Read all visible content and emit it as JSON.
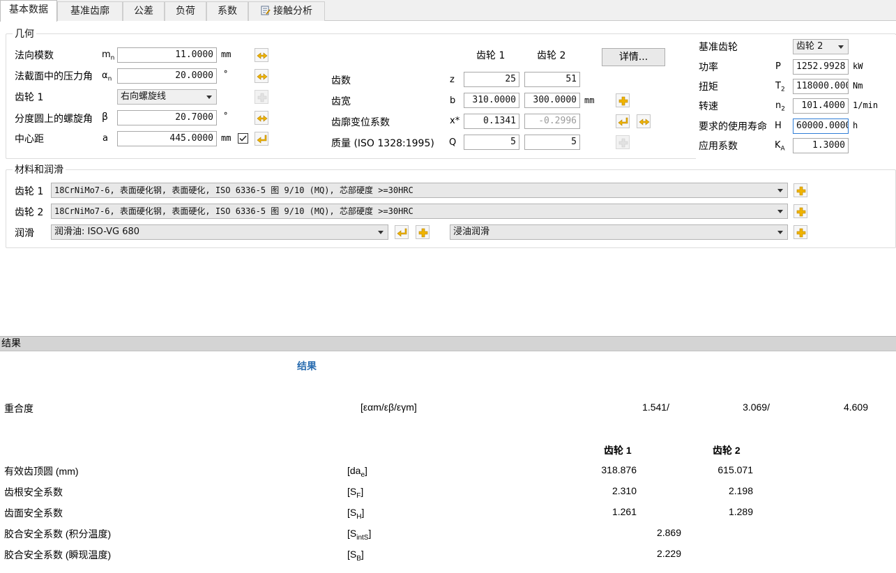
{
  "tabs": [
    "基本数据",
    "基准齿廓",
    "公差",
    "负荷",
    "系数",
    "接触分析"
  ],
  "geometry": {
    "title": "几何",
    "rows": [
      {
        "label": "法向模数",
        "symbol": "m",
        "sub": "n",
        "value": "11.0000",
        "unit": "mm"
      },
      {
        "label": "法截面中的压力角",
        "symbol": "α",
        "sub": "n",
        "value": "20.0000",
        "unit": "°"
      },
      {
        "label": "齿轮 1",
        "combo": "右向螺旋线"
      },
      {
        "label": "分度圆上的螺旋角",
        "symbol": "β",
        "sub": "",
        "value": "20.7000",
        "unit": "°"
      },
      {
        "label": "中心距",
        "symbol": "a",
        "sub": "",
        "value": "445.0000",
        "unit": "mm"
      }
    ],
    "gear1_header": "齿轮 1",
    "gear2_header": "齿轮 2",
    "details_button": "详情...",
    "gear_rows": [
      {
        "label": "齿数",
        "symbol": "z",
        "g1": "25",
        "g2": "51",
        "unit": ""
      },
      {
        "label": "齿宽",
        "symbol": "b",
        "g1": "310.0000",
        "g2": "300.0000",
        "unit": "mm"
      },
      {
        "label": "齿廓变位系数",
        "symbol": "x*",
        "g1": "0.1341",
        "g2": "-0.2996",
        "unit": ""
      },
      {
        "label": "质量 (ISO 1328:1995)",
        "symbol": "Q",
        "g1": "5",
        "g2": "5",
        "unit": ""
      }
    ]
  },
  "load": {
    "rows": [
      {
        "label": "基准齿轮",
        "combo": "齿轮 2"
      },
      {
        "label": "功率",
        "symbol": "P",
        "sub": "",
        "value": "1252.9928",
        "unit": "kW"
      },
      {
        "label": "扭矩",
        "symbol": "T",
        "sub": "2",
        "value": "118000.000",
        "unit": "Nm"
      },
      {
        "label": "转速",
        "symbol": "n",
        "sub": "2",
        "value": "101.4000",
        "unit": "1/min"
      },
      {
        "label": "要求的使用寿命",
        "symbol": "H",
        "sub": "",
        "value": "60000.0000",
        "unit": "h"
      },
      {
        "label": "应用系数",
        "symbol": "K",
        "sub": "A",
        "value": "1.3000",
        "unit": ""
      }
    ]
  },
  "materials": {
    "title": "材料和润滑",
    "gear1_label": "齿轮 1",
    "gear1_material": "18CrNiMo7-6, 表面硬化钢, 表面硬化, ISO 6336-5 图 9/10 (MQ), 芯部硬度 >=30HRC",
    "gear2_label": "齿轮 2",
    "gear2_material": "18CrNiMo7-6, 表面硬化钢, 表面硬化, ISO 6336-5 图 9/10 (MQ), 芯部硬度 >=30HRC",
    "lube_label": "润滑",
    "lube_oil": "润滑油: ISO-VG 680",
    "lube_method": "浸油润滑"
  },
  "results": {
    "header": "结果",
    "title": "结果",
    "contact_ratio": {
      "label": "重合度",
      "symbol": "[εαm/εβ/εγm]",
      "v1": "1.541/",
      "v2": "3.069/",
      "v3": "4.609"
    },
    "gear1_header": "齿轮 1",
    "gear2_header": "齿轮 2",
    "rows": [
      {
        "label": "有效齿顶圆 (mm)",
        "sym": "da",
        "sub": "e",
        "g1": "318.876",
        "g2": "615.071",
        "single": ""
      },
      {
        "label": "齿根安全系数",
        "sym": "S",
        "sub": "F",
        "g1": "2.310",
        "g2": "2.198",
        "single": ""
      },
      {
        "label": "齿面安全系数",
        "sym": "S",
        "sub": "H",
        "g1": "1.261",
        "g2": "1.289",
        "single": ""
      },
      {
        "label": "胶合安全系数 (积分温度)",
        "sym": "S",
        "sub": "intS",
        "g1": "",
        "g2": "",
        "single": "2.869"
      },
      {
        "label": "胶合安全系数 (瞬现温度)",
        "sym": "S",
        "sub": "B",
        "g1": "",
        "g2": "",
        "single": "2.229"
      }
    ]
  },
  "colors": {
    "accent": "#f0b400",
    "result_title": "#2a6db0",
    "focus": "#2f7dd6"
  }
}
